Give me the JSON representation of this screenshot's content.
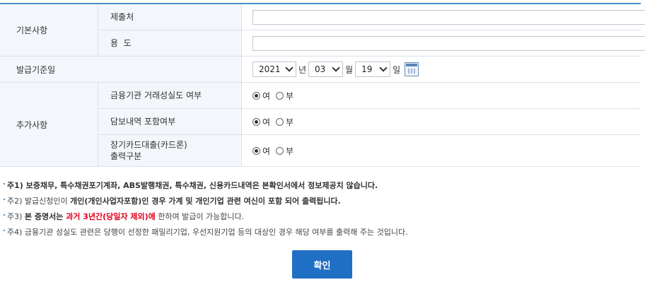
{
  "form": {
    "basic_header": "기본사항",
    "submit_to_label": "제출처",
    "submit_to_value": "",
    "purpose_label": "용  도",
    "purpose_value": "",
    "issue_date_header": "발급기준일",
    "year": "2021",
    "year_unit": "년",
    "month": "03",
    "month_unit": "월",
    "day": "19",
    "day_unit": "일",
    "extra_header": "추가사항",
    "rows": [
      {
        "label": "금융기관 거래성실도 여부",
        "yes": "여",
        "no": "부",
        "selected": "yes"
      },
      {
        "label": "담보내역 포함여부",
        "yes": "여",
        "no": "부",
        "selected": "yes"
      },
      {
        "label_line1": "장기카드대출(카드론)",
        "label_line2": "출력구분",
        "yes": "여",
        "no": "부",
        "selected": "yes"
      }
    ]
  },
  "notes": {
    "n1": "주1) 보증채무, 특수채권포기계좌, ABS발행채권, 특수채권, 신용카드내역은 본확인서에서 정보제공치 않습니다.",
    "n2_a": "주2) 발급신청인이 ",
    "n2_b": "개인(개인사업자포함)인 경우 가계 및 개인기업 관련 여신이 포함 되어 출력됩니다.",
    "n3_a": "주3) ",
    "n3_b": "본 증명서는 ",
    "n3_c": "과거 3년간(당일자 제외)에",
    "n3_d": " 한하여 발급이 가능합니다.",
    "n4": "주4) 금융기관 성실도 관련은 당행이 선정한 패밀리기업, 우선지원기업 등의 대상인 경우 해당 여부를 출력해 주는 것입니다."
  },
  "confirm_label": "확인",
  "colors": {
    "accent": "#4a90c9",
    "button": "#1f6fc5",
    "highlight": "#e3001b"
  }
}
